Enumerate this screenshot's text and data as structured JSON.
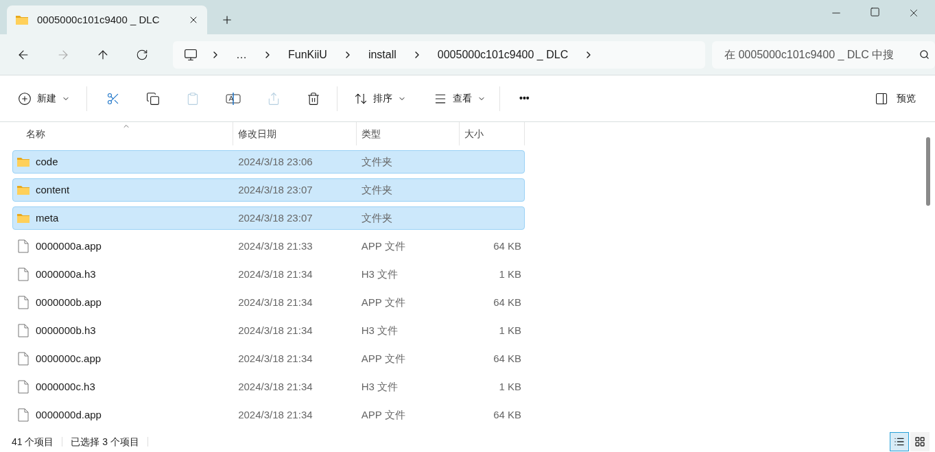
{
  "tab": {
    "title": "0005000c101c9400 _ DLC",
    "selected": true
  },
  "breadcrumb": [
    "…",
    "FunKiiU",
    "install",
    "0005000c101c9400 _ DLC"
  ],
  "search": {
    "placeholder": "在 0005000c101c9400 _ DLC 中搜"
  },
  "toolbar": {
    "new": "新建",
    "sort": "排序",
    "view": "查看",
    "more": "•••",
    "preview": "预览"
  },
  "columns": [
    "名称",
    "修改日期",
    "类型",
    "大小"
  ],
  "rows": [
    {
      "kind": "folder",
      "name": "code",
      "date": "2024/3/18 23:06",
      "type": "文件夹",
      "selected": true
    },
    {
      "kind": "folder",
      "name": "content",
      "date": "2024/3/18 23:07",
      "type": "文件夹",
      "selected": true
    },
    {
      "kind": "folder",
      "name": "meta",
      "date": "2024/3/18 23:07",
      "type": "文件夹",
      "selected": true
    },
    {
      "kind": "file",
      "name": "0000000a.app",
      "date": "2024/3/18 21:33",
      "type": "APP 文件",
      "size": "64 KB",
      "selected": false
    },
    {
      "kind": "file",
      "name": "0000000a.h3",
      "date": "2024/3/18 21:34",
      "type": "H3 文件",
      "size": "1 KB",
      "selected": false
    },
    {
      "kind": "file",
      "name": "0000000b.app",
      "date": "2024/3/18 21:34",
      "type": "APP 文件",
      "size": "64 KB",
      "selected": false
    },
    {
      "kind": "file",
      "name": "0000000b.h3",
      "date": "2024/3/18 21:34",
      "type": "H3 文件",
      "size": "1 KB",
      "selected": false
    },
    {
      "kind": "file",
      "name": "0000000c.app",
      "date": "2024/3/18 21:34",
      "type": "APP 文件",
      "size": "64 KB",
      "selected": false
    },
    {
      "kind": "file",
      "name": "0000000c.h3",
      "date": "2024/3/18 21:34",
      "type": "H3 文件",
      "size": "1 KB",
      "selected": false
    },
    {
      "kind": "file",
      "name": "0000000d.app",
      "date": "2024/3/18 21:34",
      "type": "APP 文件",
      "size": "64 KB",
      "selected": false
    }
  ],
  "status_bar": {
    "count": "41 个项目",
    "selection": "已选择 3 个项目"
  },
  "view_modes": [
    {
      "kind": "details",
      "selected": true
    },
    {
      "kind": "tiles",
      "selected": false
    }
  ]
}
